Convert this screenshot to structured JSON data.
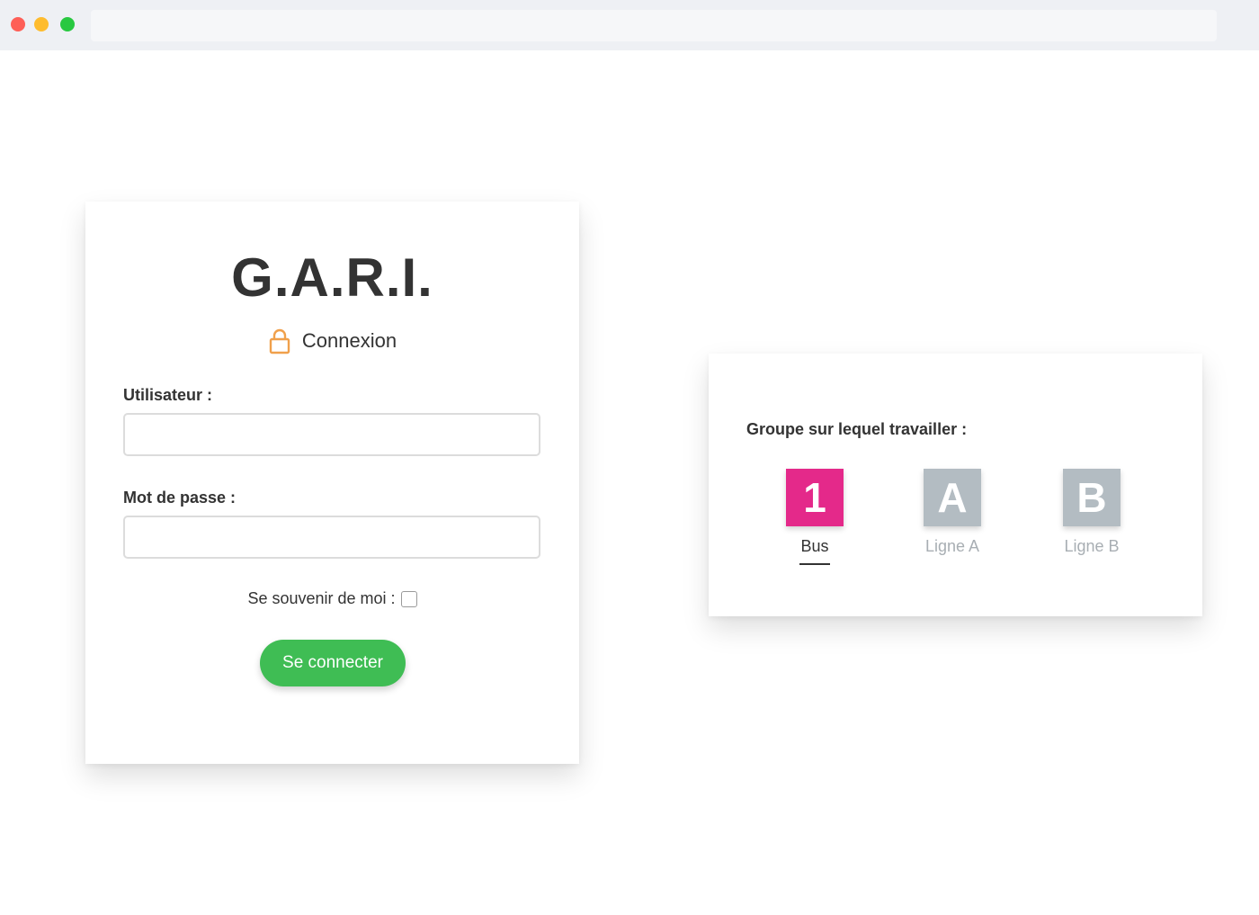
{
  "login": {
    "title": "G.A.R.I.",
    "heading": "Connexion",
    "heading_icon": "lock-icon",
    "username_label": "Utilisateur :",
    "username_value": "",
    "password_label": "Mot de passe :",
    "password_value": "",
    "remember_label": "Se souvenir de moi :",
    "remember_checked": false,
    "submit_label": "Se connecter"
  },
  "groups": {
    "heading": "Groupe sur lequel travailler :",
    "options": [
      {
        "tile": "1",
        "label": "Bus",
        "selected": true
      },
      {
        "tile": "A",
        "label": "Ligne A",
        "selected": false
      },
      {
        "tile": "B",
        "label": "Ligne B",
        "selected": false
      }
    ]
  },
  "colors": {
    "accent_green": "#3fbd54",
    "selected_group": "#e4298a",
    "unselected_group": "#b3bcc2",
    "lock_icon": "#f0a04b"
  }
}
